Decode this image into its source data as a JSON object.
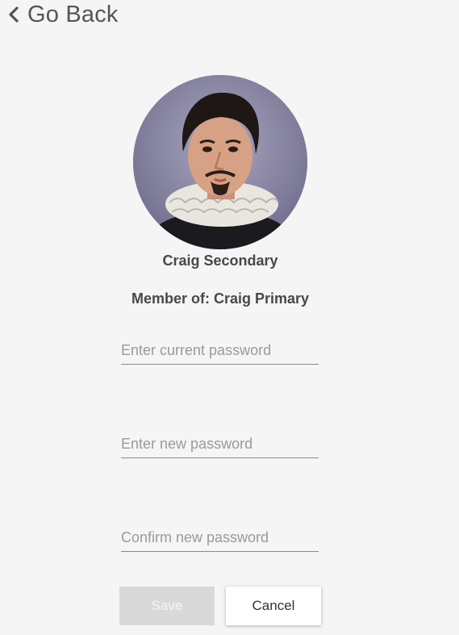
{
  "header": {
    "back_label": "Go Back",
    "back_icon": "chevron-left-icon"
  },
  "profile": {
    "avatar_icon": "user-avatar",
    "name": "Craig Secondary",
    "membership": "Member of: Craig Primary"
  },
  "form": {
    "current_password": {
      "value": "",
      "placeholder": "Enter current password"
    },
    "new_password": {
      "value": "",
      "placeholder": "Enter new password"
    },
    "confirm_password": {
      "value": "",
      "placeholder": "Confirm new password"
    }
  },
  "actions": {
    "save_label": "Save",
    "cancel_label": "Cancel"
  }
}
